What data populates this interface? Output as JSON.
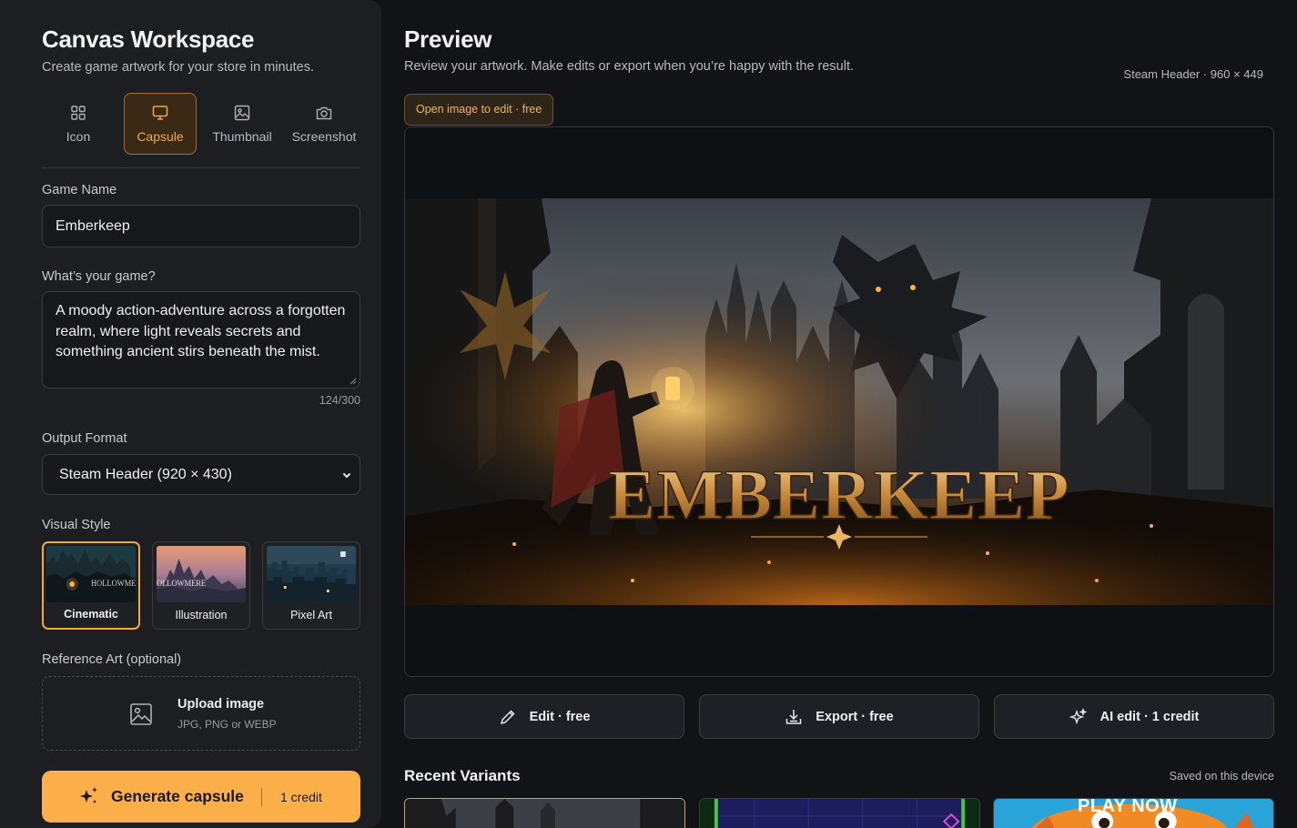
{
  "sidebar": {
    "title": "Canvas Workspace",
    "subtitle": "Create game artwork for your store in minutes.",
    "tabs": [
      {
        "label": "Icon",
        "icon": "grid-icon",
        "active": false
      },
      {
        "label": "Capsule",
        "icon": "monitor-icon",
        "active": true
      },
      {
        "label": "Thumbnail",
        "icon": "image-icon",
        "active": false
      },
      {
        "label": "Screenshot",
        "icon": "camera-icon",
        "active": false
      }
    ],
    "game_name": {
      "label": "Game Name",
      "value": "Emberkeep"
    },
    "description": {
      "label": "What’s your game?",
      "value": "A moody action-adventure across a forgotten realm, where light reveals secrets and something ancient stirs beneath the mist.",
      "count": "124/300"
    },
    "output_format": {
      "label": "Output Format",
      "value": "Steam Header (920 × 430)"
    },
    "visual_style": {
      "label": "Visual Style",
      "options": [
        {
          "name": "Cinematic",
          "selected": true,
          "thumb_text": "HOLLOWMERE"
        },
        {
          "name": "Illustration",
          "selected": false,
          "thumb_text": "OLLOWMERE"
        },
        {
          "name": "Pixel Art",
          "selected": false
        }
      ]
    },
    "reference": {
      "label": "Reference Art (optional)",
      "upload_title": "Upload image",
      "upload_sub": "JPG, PNG or WEBP"
    },
    "generate": {
      "label": "Generate capsule",
      "credit": "1 credit"
    }
  },
  "main": {
    "title": "Preview",
    "subtitle": "Review your artwork. Make edits or export when you’re happy with the result.",
    "format_meta": "Steam Header · 960 × 449",
    "edit_chip": "Open image to edit · free",
    "artwork_title": "EMBERKEEP",
    "actions": [
      {
        "label": "Edit · free",
        "icon": "pencil-icon"
      },
      {
        "label": "Export · free",
        "icon": "download-icon"
      },
      {
        "label": "AI edit · 1 credit",
        "icon": "sparkles-icon"
      }
    ],
    "recent": {
      "title": "Recent Variants",
      "meta": "Saved on this device",
      "third_variant_text": "PLAY NOW"
    }
  },
  "colors": {
    "accent": "#fdb04a",
    "accent_text": "#f5a83c",
    "background": "#121316",
    "panel": "#1d1e22"
  }
}
